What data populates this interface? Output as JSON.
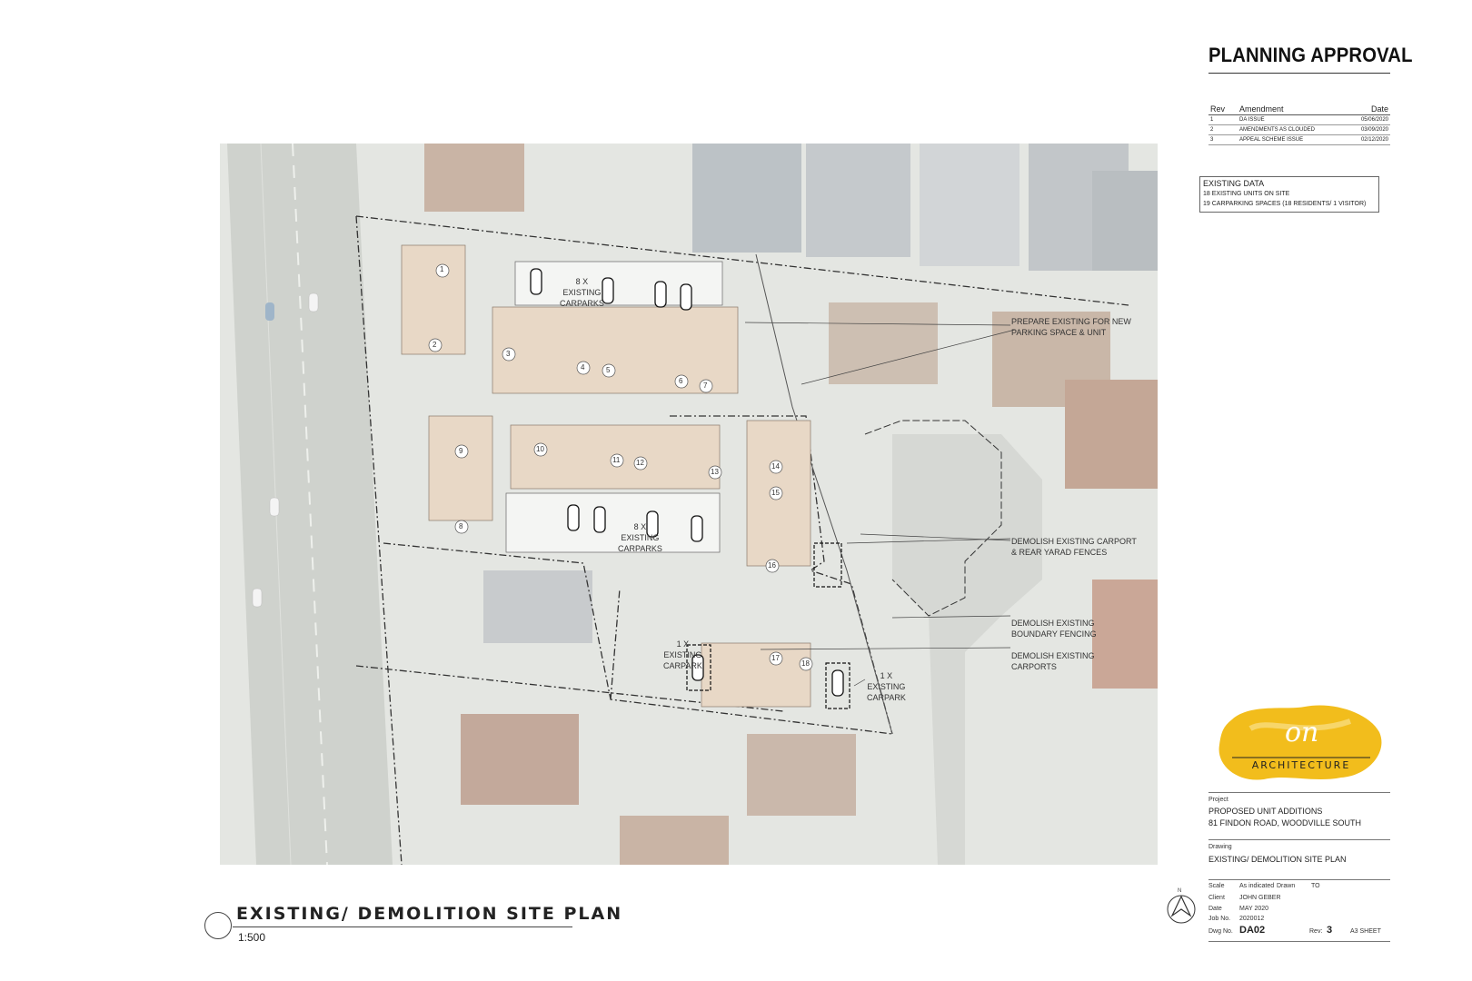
{
  "header": {
    "title": "PLANNING APPROVAL"
  },
  "revisions": {
    "headers": [
      "Rev",
      "Amendment",
      "Date"
    ],
    "rows": [
      [
        "1",
        "DA ISSUE",
        "05/06/2020"
      ],
      [
        "2",
        "AMENDMENTS AS CLOUDED",
        "03/09/2020"
      ],
      [
        "3",
        "APPEAL SCHEME ISSUE",
        "02/12/2020"
      ]
    ]
  },
  "existing_data": {
    "title": "EXISTING DATA",
    "lines": [
      "18 EXISTING UNITS ON SITE",
      "19 CARPARKING SPACES (18 RESIDENTS/ 1 VISITOR)"
    ]
  },
  "units": [
    "1",
    "2",
    "3",
    "4",
    "5",
    "6",
    "7",
    "8",
    "9",
    "10",
    "11",
    "12",
    "13",
    "14",
    "15",
    "16",
    "17",
    "18"
  ],
  "annotations": {
    "carparks_top": [
      "8 X",
      "EXISTING",
      "CARPARKS"
    ],
    "carparks_mid": [
      "8 X",
      "EXISTING",
      "CARPARKS"
    ],
    "carpark_left": [
      "1 X",
      "EXISTING",
      "CARPARK"
    ],
    "carpark_right": [
      "1 X",
      "EXISTING",
      "CARPARK"
    ],
    "prepare": [
      "PREPARE EXISTING FOR NEW",
      "PARKING SPACE & UNIT"
    ],
    "demolish_carport": [
      "DEMOLISH EXISTING CARPORT",
      "& REAR YARAD FENCES"
    ],
    "demolish_boundary": [
      "DEMOLISH EXISTING",
      "BOUNDARY FENCING"
    ],
    "demolish_carports": [
      "DEMOLISH EXISTING",
      "CARPORTS"
    ]
  },
  "plan": {
    "title": "EXISTING/ DEMOLITION SITE PLAN",
    "scale": "1:500"
  },
  "logo": {
    "text_main": "on",
    "text_sub": "ARCHITECTURE"
  },
  "title_block": {
    "project_label": "Project",
    "project_lines": [
      "PROPOSED UNIT ADDITIONS",
      "81 FINDON ROAD, WOODVILLE SOUTH"
    ],
    "drawing_label": "Drawing",
    "drawing_name": "EXISTING/ DEMOLITION SITE PLAN",
    "scale_label": "Scale",
    "scale_value": "As indicated",
    "drawn_label": "Drawn",
    "drawn_value": "TO",
    "client_label": "Client",
    "client_value": "JOHN GEBER",
    "date_label": "Date",
    "date_value": "MAY 2020",
    "job_label": "Job No.",
    "job_value": "2020012",
    "dwg_label": "Dwg No.",
    "dwg_value": "DA02",
    "rev_label": "Rev:",
    "rev_value": "3",
    "sheet": "A3 SHEET",
    "north": "N"
  },
  "colors": {
    "logo_yellow": "#f2bd1c",
    "unit_fill": "#e8d8c6",
    "aerial_base": "#e4e6e2",
    "road": "#cfd2cd"
  }
}
